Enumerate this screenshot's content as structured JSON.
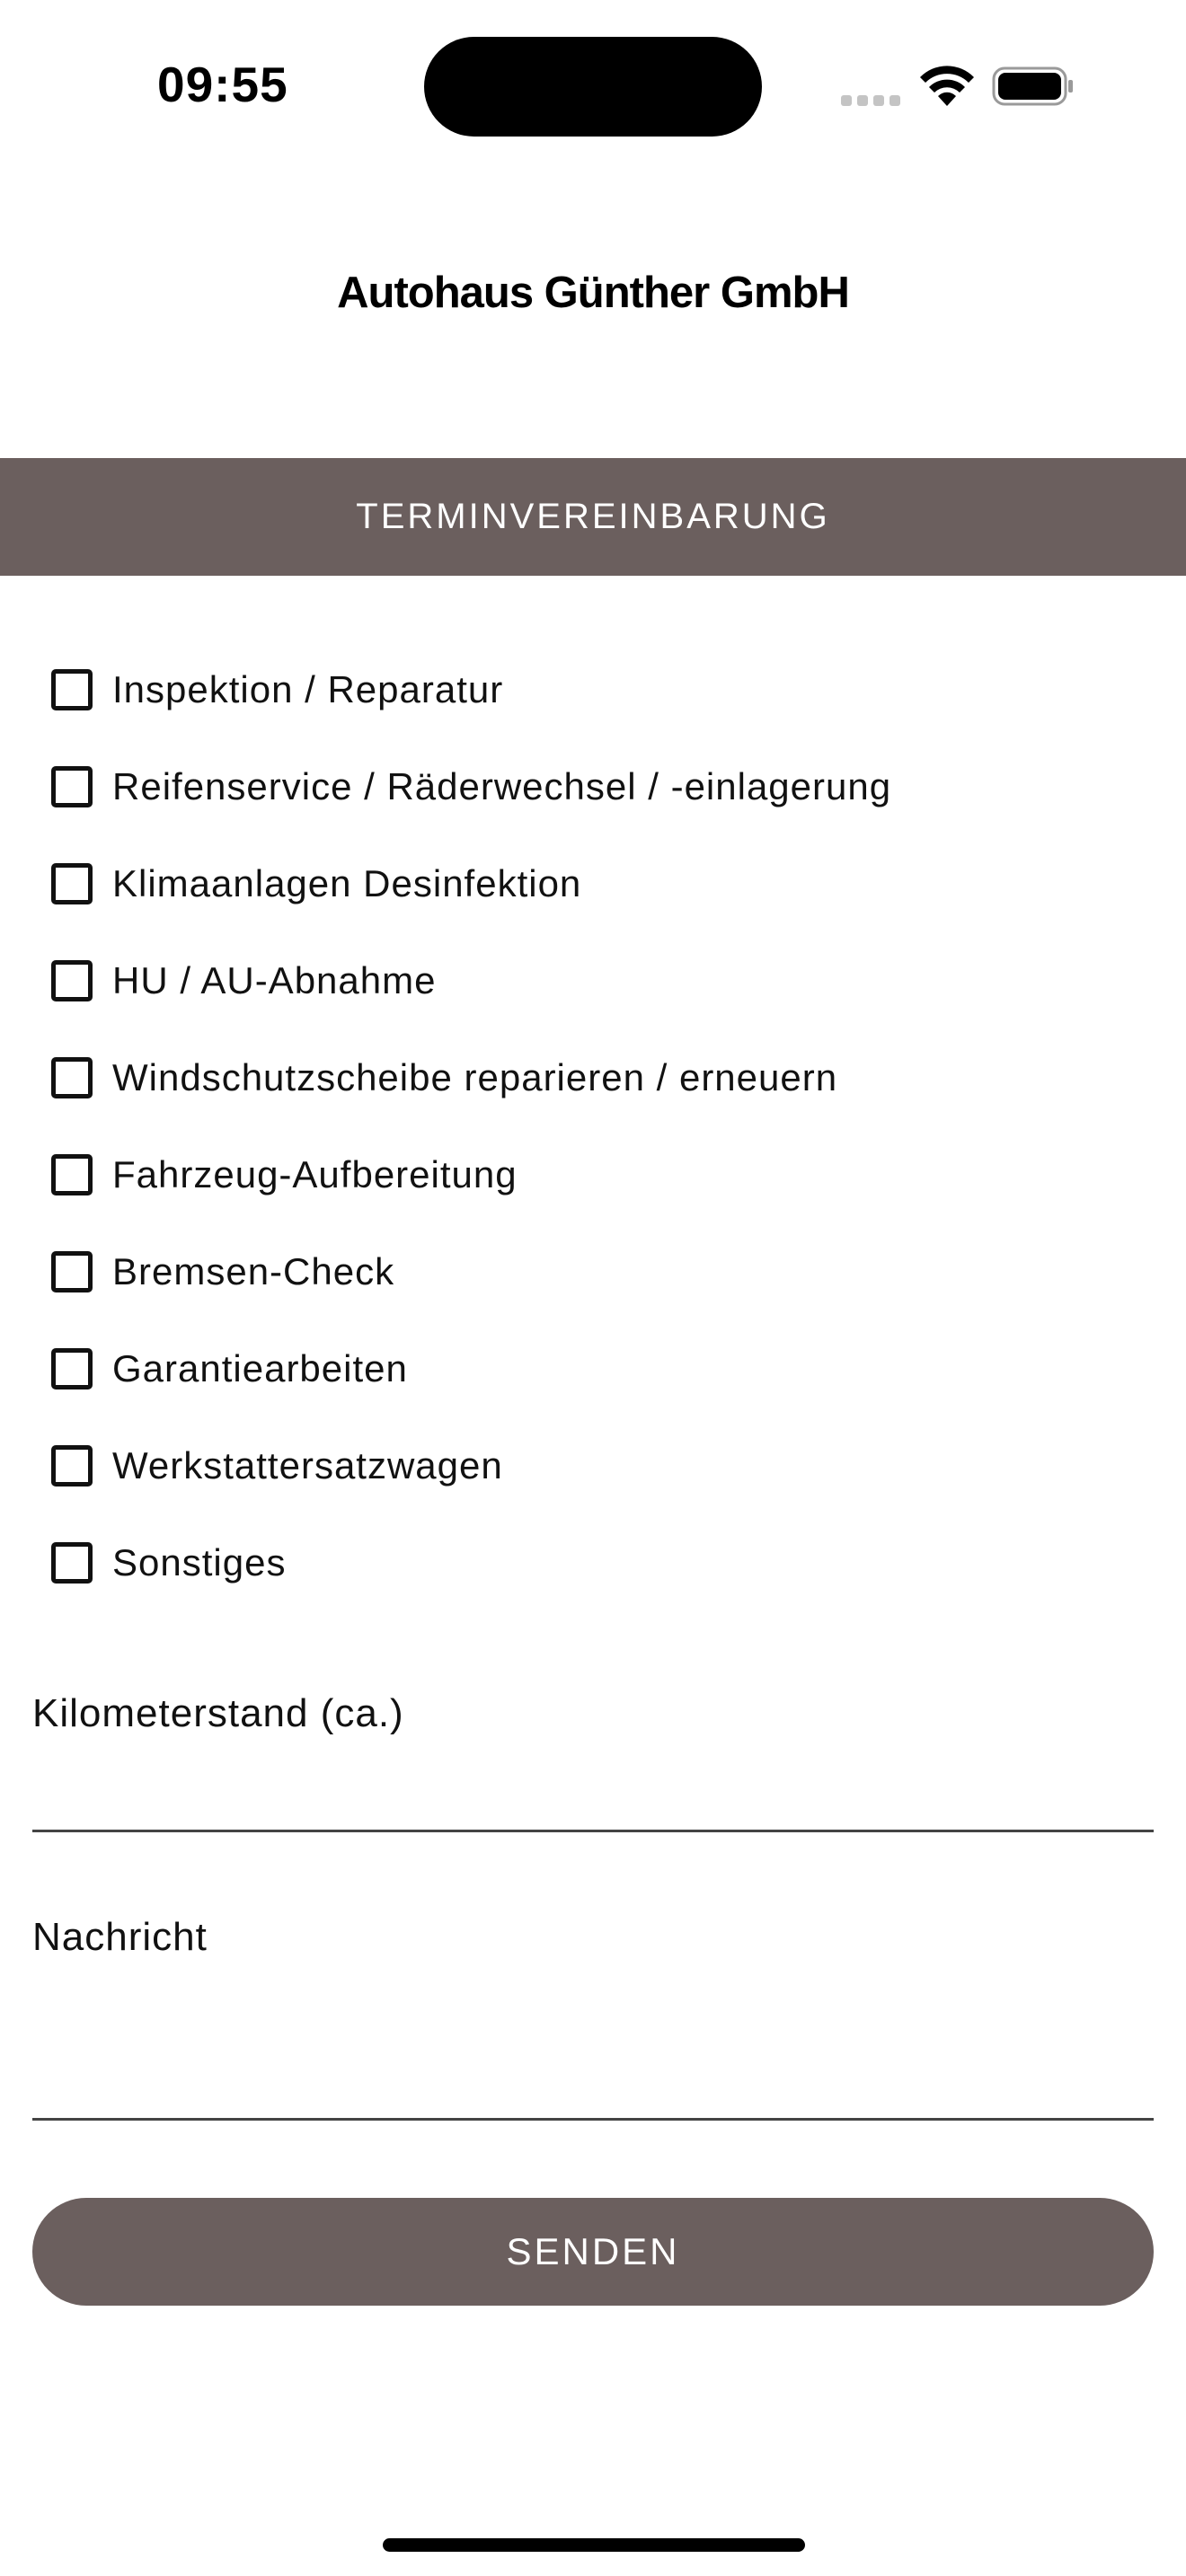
{
  "status_bar": {
    "time": "09:55",
    "icons": [
      "cellular-signal-icon",
      "wifi-icon",
      "battery-icon"
    ]
  },
  "header": {
    "title": "Autohaus Günther GmbH"
  },
  "section": {
    "title": "TERMINVEREINBARUNG"
  },
  "services": [
    {
      "label": "Inspektion / Reparatur",
      "checked": false
    },
    {
      "label": "Reifenservice / Räderwechsel / -einlagerung",
      "checked": false
    },
    {
      "label": "Klimaanlagen Desinfektion",
      "checked": false
    },
    {
      "label": "HU / AU-Abnahme",
      "checked": false
    },
    {
      "label": "Windschutzscheibe reparieren / erneuern",
      "checked": false
    },
    {
      "label": "Fahrzeug-Aufbereitung",
      "checked": false
    },
    {
      "label": "Bremsen-Check",
      "checked": false
    },
    {
      "label": "Garantiearbeiten",
      "checked": false
    },
    {
      "label": "Werkstattersatzwagen",
      "checked": false
    },
    {
      "label": "Sonstiges",
      "checked": false
    }
  ],
  "form": {
    "mileage_label": "Kilometerstand (ca.)",
    "mileage_value": "",
    "message_label": "Nachricht",
    "message_value": "",
    "submit_label": "SENDEN"
  },
  "colors": {
    "accent": "#6b5f5e",
    "text": "#111111",
    "background": "#ffffff"
  }
}
